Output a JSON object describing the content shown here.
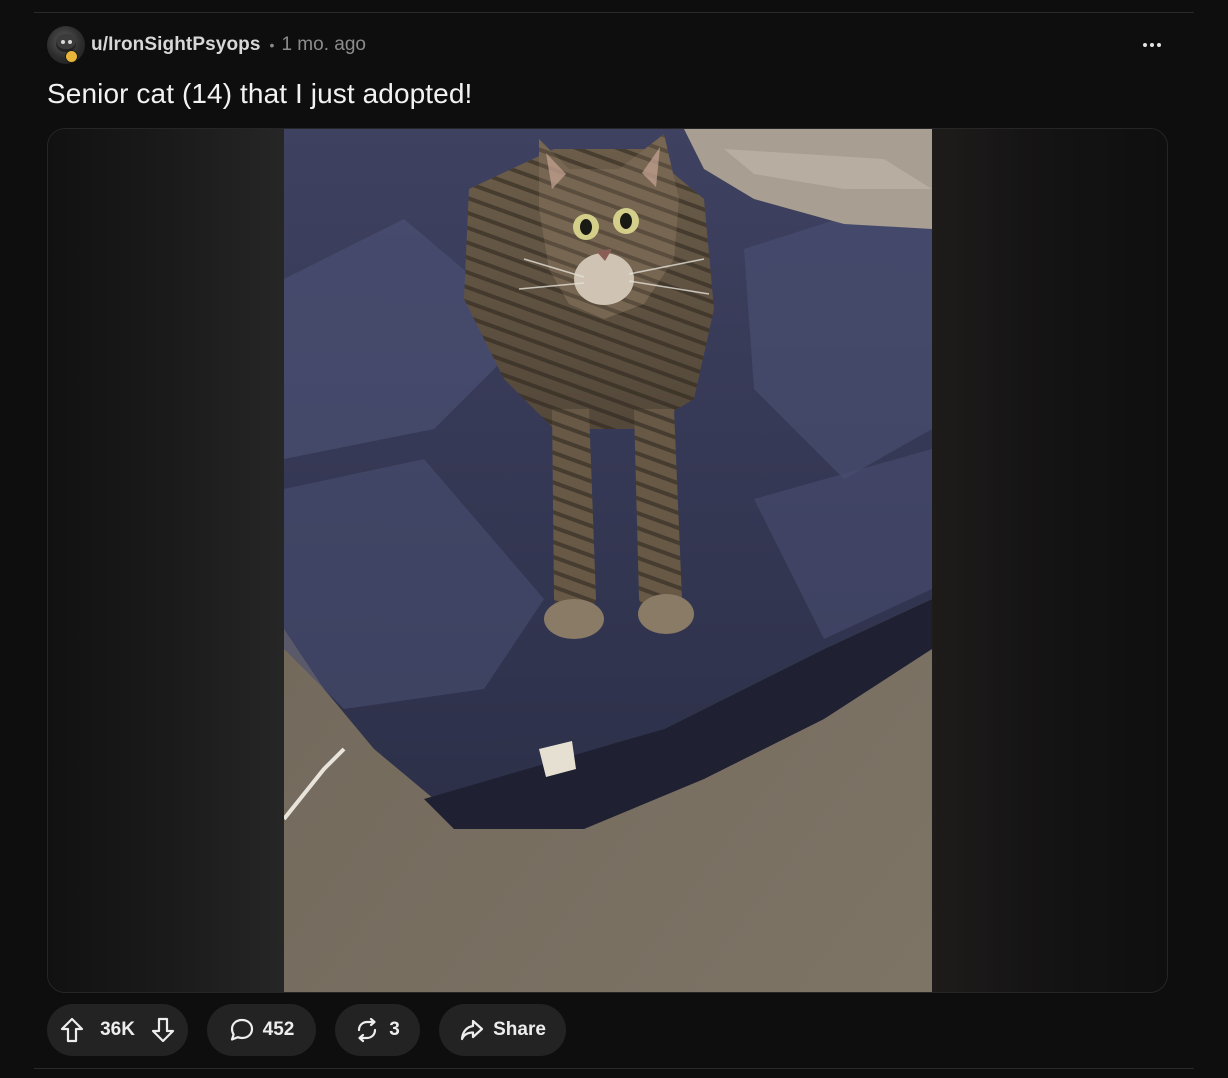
{
  "post": {
    "author": "u/IronSightPsyops",
    "separator": "•",
    "time_ago": "1 mo. ago",
    "title": "Senior cat (14) that I just adopted!"
  },
  "actions": {
    "upvote_icon": "arrow-up-icon",
    "downvote_icon": "arrow-down-icon",
    "vote_count": "36K",
    "comments_icon": "speech-bubble-icon",
    "comment_count": "452",
    "crosspost_icon": "repost-arrows-icon",
    "crosspost_count": "3",
    "share_icon": "share-arrow-icon",
    "share_label": "Share",
    "more_icon": "ellipsis-icon"
  },
  "colors": {
    "background": "#0e0e0e",
    "pill": "#232323",
    "text": "#f2f2f2",
    "muted": "#8c8c8c"
  }
}
